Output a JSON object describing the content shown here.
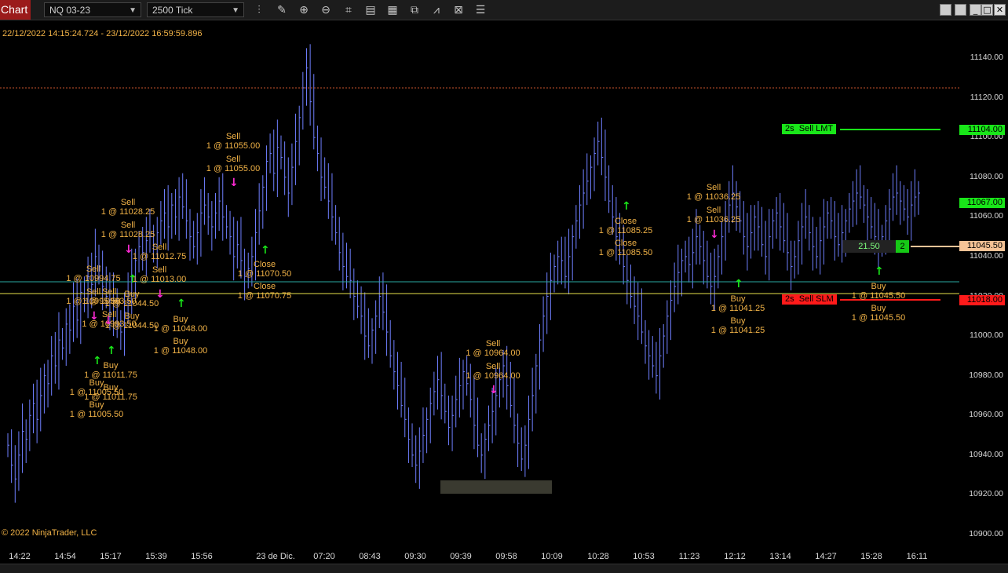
{
  "toolbar": {
    "chart_tab": "Chart",
    "instrument": "NQ 03-23",
    "interval": "2500 Tick",
    "icons": [
      "bar-type-icon",
      "draw-pencil-icon",
      "zoom-in-icon",
      "zoom-out-icon",
      "crosshair-icon",
      "data-box-icon",
      "properties-icon",
      "chart-trader-icon",
      "strategies-icon",
      "indicators-icon",
      "templates-icon"
    ],
    "window_buttons": [
      "restore",
      "minimize",
      "maximize",
      "close"
    ]
  },
  "chart": {
    "date_range": "22/12/2022 14:15:24.724 - 23/12/2022 16:59:59.896",
    "copyright": "© 2022 NinjaTrader, LLC",
    "colors": {
      "bars": "#6f7fff",
      "buy": "#19e619",
      "sell": "#ff2bd6",
      "text": "#f2b347",
      "sell_lmt": "#19e619",
      "sell_slm": "#ff1a1a",
      "position": "#f5c396"
    }
  },
  "chart_data": {
    "type": "ohlc",
    "price_axis": [
      "11140.00",
      "11120.00",
      "11100.00",
      "11080.00",
      "11060.00",
      "11040.00",
      "11020.00",
      "11000.00",
      "10980.00",
      "10960.00",
      "10940.00",
      "10920.00",
      "10900.00"
    ],
    "time_axis": [
      "14:22",
      "14:54",
      "15:17",
      "15:39",
      "15:56",
      "23 de Dic.",
      "07:20",
      "08:43",
      "09:30",
      "09:39",
      "09:58",
      "10:09",
      "10:28",
      "10:53",
      "11:23",
      "12:12",
      "13:14",
      "14:27",
      "15:28",
      "16:11"
    ],
    "ylim": [
      10900,
      11150
    ],
    "orders": {
      "sell_lmt": {
        "qty": "2s",
        "label": "Sell LMT",
        "price": "11104.00"
      },
      "sell_slm": {
        "qty": "2s",
        "label": "Sell SLM",
        "price": "11018.00"
      },
      "current_price": "11067.00",
      "position_price": "11045.50",
      "pnl": "21.50",
      "position_qty": "2"
    },
    "executions": [
      {
        "l1": "Sell",
        "l2": "1 @ 11055.00"
      },
      {
        "l1": "Sell",
        "l2": "1 @ 11055.00"
      },
      {
        "l1": "Sell",
        "l2": "1 @ 11028.25"
      },
      {
        "l1": "Sell",
        "l2": "1 @ 11028.25"
      },
      {
        "l1": "Sell",
        "l2": "1 @ 11012.75"
      },
      {
        "l1": "Sell",
        "l2": "1 @ 11013.00"
      },
      {
        "l1": "Sell",
        "l2": "1 @ 10994.75"
      },
      {
        "l1": "Sell",
        "l2": "1 @ 10995.50"
      },
      {
        "l1": "Sell",
        "l2": "1 @ 10993.50"
      },
      {
        "l1": "Sell",
        "l2": "1 @ 10993.50"
      },
      {
        "l1": "Buy",
        "l2": "1 @ 11044.50"
      },
      {
        "l1": "Buy",
        "l2": "1 @ 11044.50"
      },
      {
        "l1": "Buy",
        "l2": "1 @ 11048.00"
      },
      {
        "l1": "Buy",
        "l2": "1 @ 11048.00"
      },
      {
        "l1": "Buy",
        "l2": "1 @ 11011.75"
      },
      {
        "l1": "Buy",
        "l2": "1 @ 11005.50"
      },
      {
        "l1": "Buy",
        "l2": "1 @ 11011.75"
      },
      {
        "l1": "Buy",
        "l2": "1 @ 11005.50"
      },
      {
        "l1": "Close",
        "l2": "1 @ 11070.50"
      },
      {
        "l1": "Close",
        "l2": "1 @ 11070.75"
      },
      {
        "l1": "Sell",
        "l2": "1 @ 10964.00"
      },
      {
        "l1": "Sell",
        "l2": "1 @ 10964.00"
      },
      {
        "l1": "Close",
        "l2": "1 @ 11085.25"
      },
      {
        "l1": "Close",
        "l2": "1 @ 11085.50"
      },
      {
        "l1": "Sell",
        "l2": "1 @ 11036.25"
      },
      {
        "l1": "Sell",
        "l2": "1 @ 11036.25"
      },
      {
        "l1": "Buy",
        "l2": "1 @ 11041.25"
      },
      {
        "l1": "Buy",
        "l2": "1 @ 11041.25"
      },
      {
        "l1": "Buy",
        "l2": "1 @ 11045.50"
      },
      {
        "l1": "Buy",
        "l2": "1 @ 11045.50"
      }
    ],
    "closes": [
      10945,
      10935,
      10928,
      10940,
      10952,
      10948,
      10960,
      10966,
      10958,
      10970,
      10980,
      10976,
      10990,
      10985,
      10998,
      10994,
      11006,
      11003,
      11015,
      11008,
      11022,
      11018,
      11030,
      11026,
      11040,
      11035,
      11025,
      11020,
      11012,
      11018,
      11005,
      11002,
      11012,
      11020,
      11030,
      11038,
      11045,
      11042,
      11048,
      11050,
      11046,
      11052,
      11058,
      11062,
      11055,
      11066,
      11060,
      11070,
      11065,
      11058,
      11050,
      11045,
      11052,
      11062,
      11066,
      11060,
      11055,
      11062,
      11068,
      11060,
      11055,
      11050,
      11040,
      11046,
      11038,
      11030,
      11034,
      11040,
      11052,
      11063,
      11075,
      11088,
      11092,
      11082,
      11095,
      11090,
      11080,
      11072,
      11085,
      11098,
      11110,
      11125,
      11135,
      11118,
      11100,
      11092,
      11080,
      11075,
      11068,
      11060,
      11052,
      11042,
      11035,
      11030,
      11028,
      11020,
      11015,
      11010,
      11000,
      10995,
      11003,
      11010,
      11020,
      11012,
      11002,
      10990,
      10982,
      10975,
      10965,
      10958,
      10948,
      10940,
      10935,
      10942,
      10950,
      10958,
      10966,
      10972,
      10978,
      10970,
      10962,
      10954,
      10960,
      10968,
      10975,
      10982,
      10976,
      10968,
      10955,
      10945,
      10940,
      10948,
      10955,
      10962,
      10970,
      10978,
      10985,
      10975,
      10965,
      10955,
      10946,
      10938,
      10945,
      10958,
      10970,
      10985,
      10998,
      11010,
      11020,
      11028,
      11035,
      11040,
      11038,
      11030,
      11040,
      11050,
      11058,
      11066,
      11072,
      11078,
      11085,
      11092,
      11098,
      11090,
      11080,
      11068,
      11060,
      11050,
      11042,
      11035,
      11028,
      11020,
      11015,
      11010,
      11002,
      10995,
      10990,
      10985,
      10980,
      10990,
      11000,
      11010,
      11018,
      11025,
      11032,
      11038,
      11040,
      11036,
      11042,
      11050,
      11045,
      11038,
      11030,
      11025,
      11030,
      11040,
      11050,
      11058,
      11066,
      11072,
      11065,
      11058,
      11050,
      11045,
      11052,
      11060,
      11055,
      11046,
      11040,
      11050,
      11058,
      11062,
      11055,
      11048,
      11042,
      11035,
      11040,
      11048,
      11055,
      11060,
      11052,
      11045,
      11040,
      11048,
      11055,
      11062,
      11058,
      11050,
      11046,
      11052,
      11058,
      11064,
      11068,
      11072,
      11070,
      11066,
      11060,
      11055,
      11050,
      11046,
      11050,
      11058,
      11064,
      11070,
      11072,
      11068,
      11064,
      11060,
      11066,
      11070,
      11072
    ]
  }
}
